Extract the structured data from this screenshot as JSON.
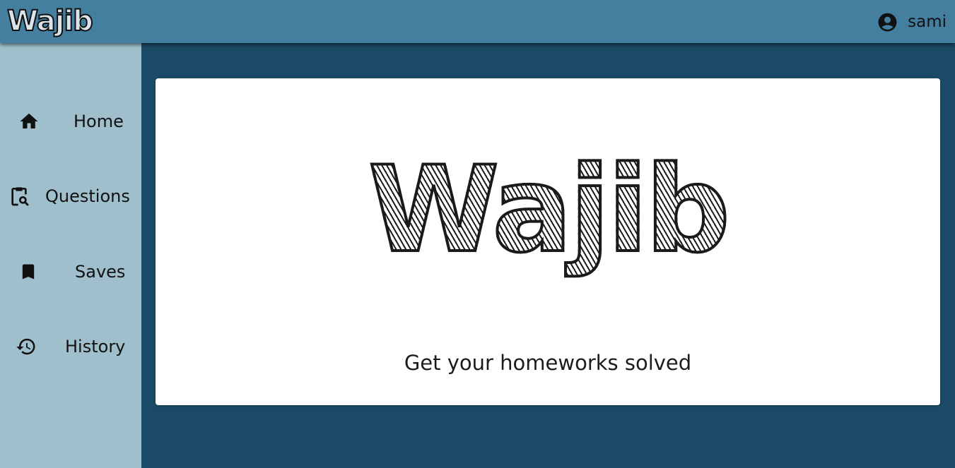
{
  "header": {
    "brand": "Wajib",
    "user": {
      "name": "sami",
      "icon": "account-circle-icon"
    },
    "background_color": "#447f9f"
  },
  "sidebar": {
    "background_color": "#9ebfcb",
    "items": [
      {
        "label": "Home",
        "icon": "home-icon"
      },
      {
        "label": "Questions",
        "icon": "clipboard-search-icon"
      },
      {
        "label": "Saves",
        "icon": "bookmark-icon"
      },
      {
        "label": "History",
        "icon": "history-icon"
      }
    ]
  },
  "main": {
    "background_color": "#1b4a66",
    "hero": {
      "logo_text": "Wajib",
      "tagline": "Get your homeworks solved"
    }
  }
}
